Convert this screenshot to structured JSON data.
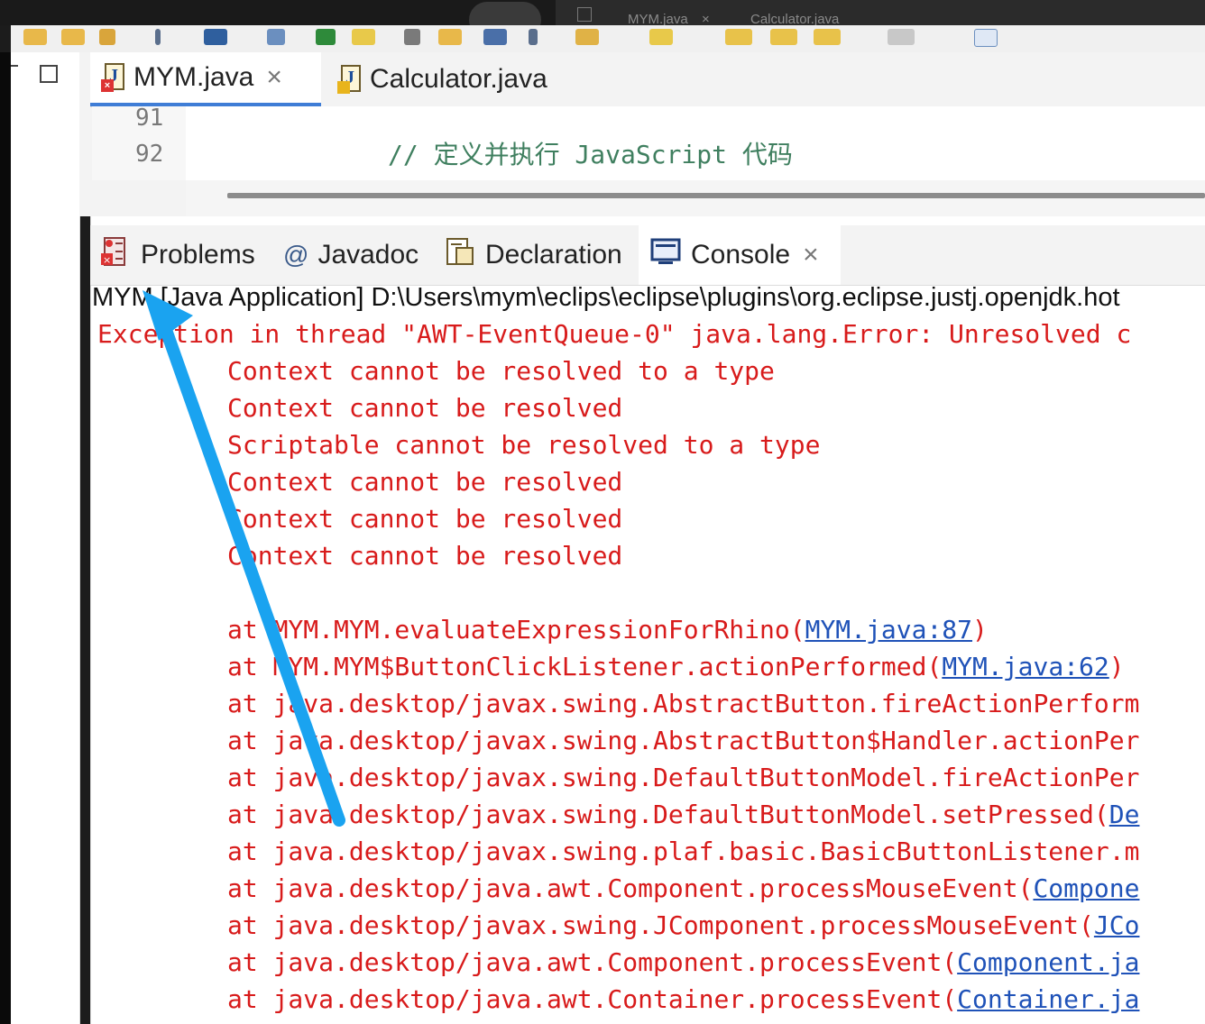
{
  "topbar": {
    "tab1": "MYM.java",
    "tab1_close": "×",
    "tab2": "Calculator.java"
  },
  "editor": {
    "tabs": [
      {
        "label": "MYM.java",
        "close": "×"
      },
      {
        "label": "Calculator.java"
      }
    ],
    "lines": [
      {
        "number": "91",
        "text": ""
      },
      {
        "number": "92",
        "text": "// 定义并执行 JavaScript 代码"
      }
    ]
  },
  "views": {
    "tabs": [
      {
        "label": "Problems",
        "icon": "problems-icon"
      },
      {
        "label": "Javadoc",
        "icon": "at-icon"
      },
      {
        "label": "Declaration",
        "icon": "declaration-icon"
      },
      {
        "label": "Console",
        "icon": "console-icon",
        "close": "×"
      }
    ]
  },
  "console": {
    "title": "MYM [Java Application] D:\\Users\\mym\\eclips\\eclipse\\plugins\\org.eclipse.justj.openjdk.hot",
    "lines": [
      {
        "text": "Exception in thread \"AWT-EventQueue-0\" java.lang.Error: Unresolved c",
        "link": ""
      },
      {
        "text": "Context cannot be resolved to a type",
        "link": ""
      },
      {
        "text": "Context cannot be resolved",
        "link": ""
      },
      {
        "text": "Scriptable cannot be resolved to a type",
        "link": ""
      },
      {
        "text": "Context cannot be resolved",
        "link": ""
      },
      {
        "text": "Context cannot be resolved",
        "link": ""
      },
      {
        "text": "Context cannot be resolved",
        "link": ""
      },
      {
        "text": "",
        "link": ""
      },
      {
        "text": "at MYM.MYM.evaluateExpressionForRhino(",
        "link": "MYM.java:87",
        "tail": ")"
      },
      {
        "text": "at MYM.MYM$ButtonClickListener.actionPerformed(",
        "link": "MYM.java:62",
        "tail": ")"
      },
      {
        "text": "at java.desktop/javax.swing.AbstractButton.fireActionPerform",
        "link": ""
      },
      {
        "text": "at java.desktop/javax.swing.AbstractButton$Handler.actionPer",
        "link": ""
      },
      {
        "text": "at java.desktop/javax.swing.DefaultButtonModel.fireActionPer",
        "link": ""
      },
      {
        "text": "at java.desktop/javax.swing.DefaultButtonModel.setPressed(",
        "link": "De"
      },
      {
        "text": "at java.desktop/javax.swing.plaf.basic.BasicButtonListener.m",
        "link": ""
      },
      {
        "text": "at java.desktop/java.awt.Component.processMouseEvent(",
        "link": "Compone"
      },
      {
        "text": "at java.desktop/javax.swing.JComponent.processMouseEvent(",
        "link": "JCo"
      },
      {
        "text": "at java.desktop/java.awt.Component.processEvent(",
        "link": "Component.ja"
      },
      {
        "text": "at java.desktop/java.awt.Container.processEvent(",
        "link": "Container.ja"
      }
    ]
  },
  "colors": {
    "error_text": "#d81b1b",
    "link": "#1f52b8",
    "comment": "#3f7f5f",
    "active_tab_underline": "#3f7dd6",
    "annotation_arrow": "#1aa3f0"
  }
}
